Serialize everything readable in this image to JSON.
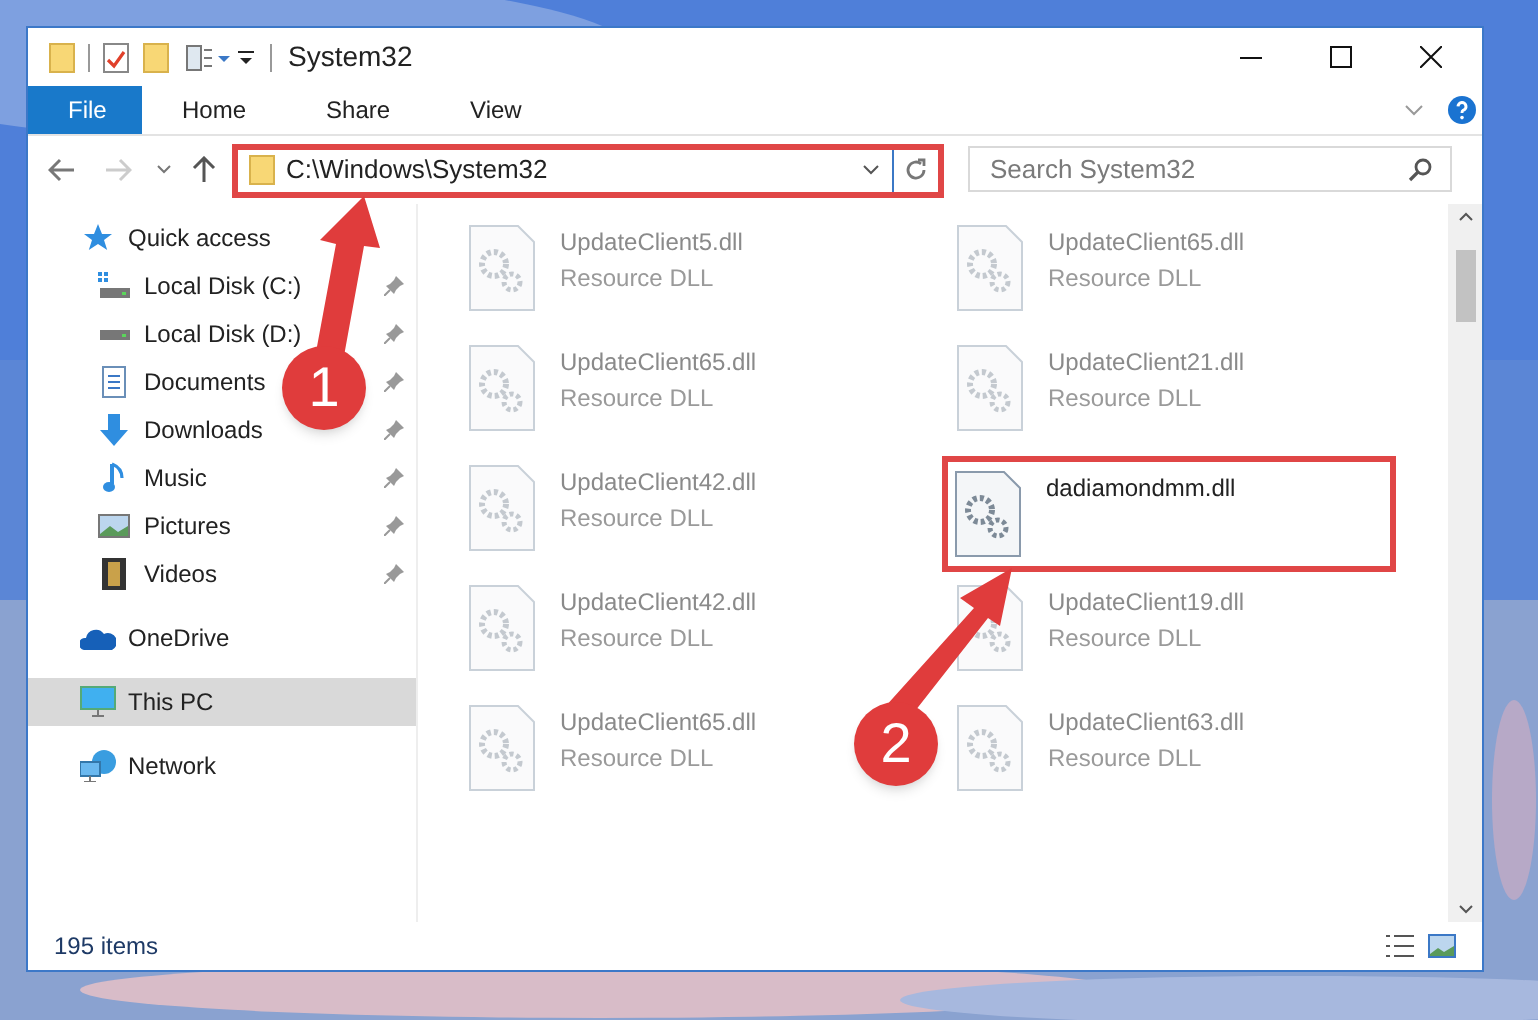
{
  "window": {
    "title": "System32"
  },
  "ribbon_tabs": [
    {
      "label": "File",
      "selected": true
    },
    {
      "label": "Home",
      "selected": false
    },
    {
      "label": "Share",
      "selected": false
    },
    {
      "label": "View",
      "selected": false
    }
  ],
  "address_bar": {
    "path": "C:\\Windows\\System32",
    "highlighted": true
  },
  "search": {
    "placeholder": "Search System32"
  },
  "sidebar": {
    "items": [
      {
        "label": "Quick access",
        "pinned": false,
        "selected": false
      },
      {
        "label": "Local Disk (C:)",
        "pinned": true,
        "selected": false
      },
      {
        "label": "Local Disk (D:)",
        "pinned": true,
        "selected": false
      },
      {
        "label": "Documents",
        "pinned": true,
        "selected": false
      },
      {
        "label": "Downloads",
        "pinned": true,
        "selected": false
      },
      {
        "label": "Music",
        "pinned": true,
        "selected": false
      },
      {
        "label": "Pictures",
        "pinned": true,
        "selected": false
      },
      {
        "label": "Videos",
        "pinned": true,
        "selected": false
      },
      {
        "label": "OneDrive",
        "pinned": false,
        "selected": false
      },
      {
        "label": "This PC",
        "pinned": false,
        "selected": true
      },
      {
        "label": "Network",
        "pinned": false,
        "selected": false
      }
    ]
  },
  "files": [
    {
      "name": "UpdateClient5.dll",
      "type": "Resource DLL",
      "blurred": true,
      "highlighted": false
    },
    {
      "name": "UpdateClient65.dll",
      "type": "Resource DLL",
      "blurred": true,
      "highlighted": false
    },
    {
      "name": "UpdateClient65.dll",
      "type": "Resource DLL",
      "blurred": true,
      "highlighted": false
    },
    {
      "name": "UpdateClient21.dll",
      "type": "Resource DLL",
      "blurred": true,
      "highlighted": false
    },
    {
      "name": "UpdateClient42.dll",
      "type": "Resource DLL",
      "blurred": true,
      "highlighted": false
    },
    {
      "name": "dadiamondmm.dll",
      "blurred": false,
      "highlighted": true
    },
    {
      "name": "UpdateClient42.dll",
      "type": "Resource DLL",
      "blurred": true,
      "highlighted": false
    },
    {
      "name": "UpdateClient19.dll",
      "type": "Resource DLL",
      "blurred": true,
      "highlighted": false
    },
    {
      "name": "UpdateClient65.dll",
      "type": "Resource DLL",
      "blurred": true,
      "highlighted": false
    },
    {
      "name": "UpdateClient63.dll",
      "type": "Resource DLL",
      "blurred": true,
      "highlighted": false
    }
  ],
  "status_bar": {
    "item_count": "195 items"
  },
  "annotations": [
    {
      "label": "1"
    },
    {
      "label": "2"
    }
  ]
}
